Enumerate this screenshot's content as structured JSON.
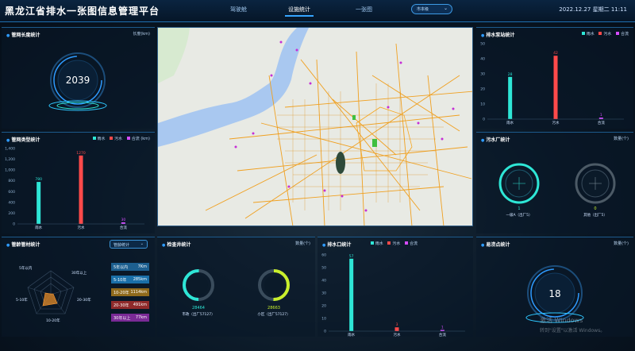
{
  "app": {
    "title": "黑龙江省排水一张图信息管理平台",
    "datetime": "2022.12.27  星期二  11:11"
  },
  "nav": {
    "tabs": [
      "驾驶舱",
      "设施统计",
      "一张图"
    ],
    "active_index": 1,
    "city_select": "市本级"
  },
  "colors": {
    "rain": "#2ee6d6",
    "sewage": "#ff4a4a",
    "combined": "#d54cff",
    "accent": "#2e9bff"
  },
  "legend": {
    "rain": "雨水",
    "sewage": "污水",
    "combined": "合流"
  },
  "pipe_length": {
    "title": "管网长度统计",
    "unit": "长度(km)",
    "value": "2039"
  },
  "pipe_type": {
    "title": "管网类型统计",
    "unit": "(km)",
    "chart_data": {
      "type": "bar",
      "categories": [
        "雨水",
        "污水",
        "合流"
      ],
      "values": [
        780,
        1270,
        30
      ],
      "value_labels": [
        "780",
        "1270",
        "30"
      ],
      "ylim": [
        0,
        1400
      ],
      "yticks": [
        "0",
        "200",
        "400",
        "600",
        "800",
        "1,000",
        "1,200",
        "1,400"
      ]
    }
  },
  "pump_station": {
    "title": "排水泵站统计",
    "chart_data": {
      "type": "bar",
      "categories": [
        "雨水",
        "污水",
        "合流"
      ],
      "values": [
        28,
        42,
        1
      ],
      "value_labels": [
        "28",
        "42",
        "1"
      ],
      "ylim": [
        0,
        50
      ],
      "yticks": [
        "0",
        "10",
        "20",
        "30",
        "40",
        "50"
      ]
    }
  },
  "sewage_plant": {
    "title": "污水厂统计",
    "unit": "数量(个)",
    "gauges": [
      {
        "value": "1",
        "label": "一级A（出厂5）"
      },
      {
        "value": "0",
        "label": "其他（出厂5）"
      }
    ]
  },
  "pipe_age": {
    "title": "管龄管材统计",
    "dropdown": "管龄统计",
    "radar_labels": [
      "5年以内",
      "30年以上",
      "20-30年",
      "10-20年",
      "5-10年"
    ],
    "ranges": [
      {
        "label": "5年以内",
        "value": "7Km",
        "color": "#1d5f8f"
      },
      {
        "label": "5-10年",
        "value": "285km",
        "color": "#1a6fa8"
      },
      {
        "label": "10-20年",
        "value": "1114km",
        "color": "#8f6a1c"
      },
      {
        "label": "20-30年",
        "value": "491km",
        "color": "#8f2a2a"
      },
      {
        "label": "30年以上",
        "value": "77km",
        "color": "#7a2a96"
      }
    ]
  },
  "inspection_well": {
    "title": "检查井统计",
    "unit": "数量(个)",
    "gauges": [
      {
        "value": "28464",
        "label": "市政（出厂57127）"
      },
      {
        "value": "28663",
        "label": "小区（出厂57127）"
      }
    ]
  },
  "outfall": {
    "title": "排水口统计",
    "unit": "数量(个)",
    "chart_data": {
      "type": "bar",
      "categories": [
        "雨水",
        "污水",
        "合流"
      ],
      "values": [
        57,
        3,
        1
      ],
      "value_labels": [
        "57",
        "3",
        "1"
      ],
      "ylim": [
        0,
        60
      ],
      "yticks": [
        "0",
        "10",
        "20",
        "30",
        "40",
        "50",
        "60"
      ]
    }
  },
  "waterlog": {
    "title": "易涝点统计",
    "unit": "数量(个)",
    "value": "18"
  },
  "watermark": {
    "line1": "激活 Windows",
    "line2": "转到\"设置\"以激活 Windows。"
  }
}
